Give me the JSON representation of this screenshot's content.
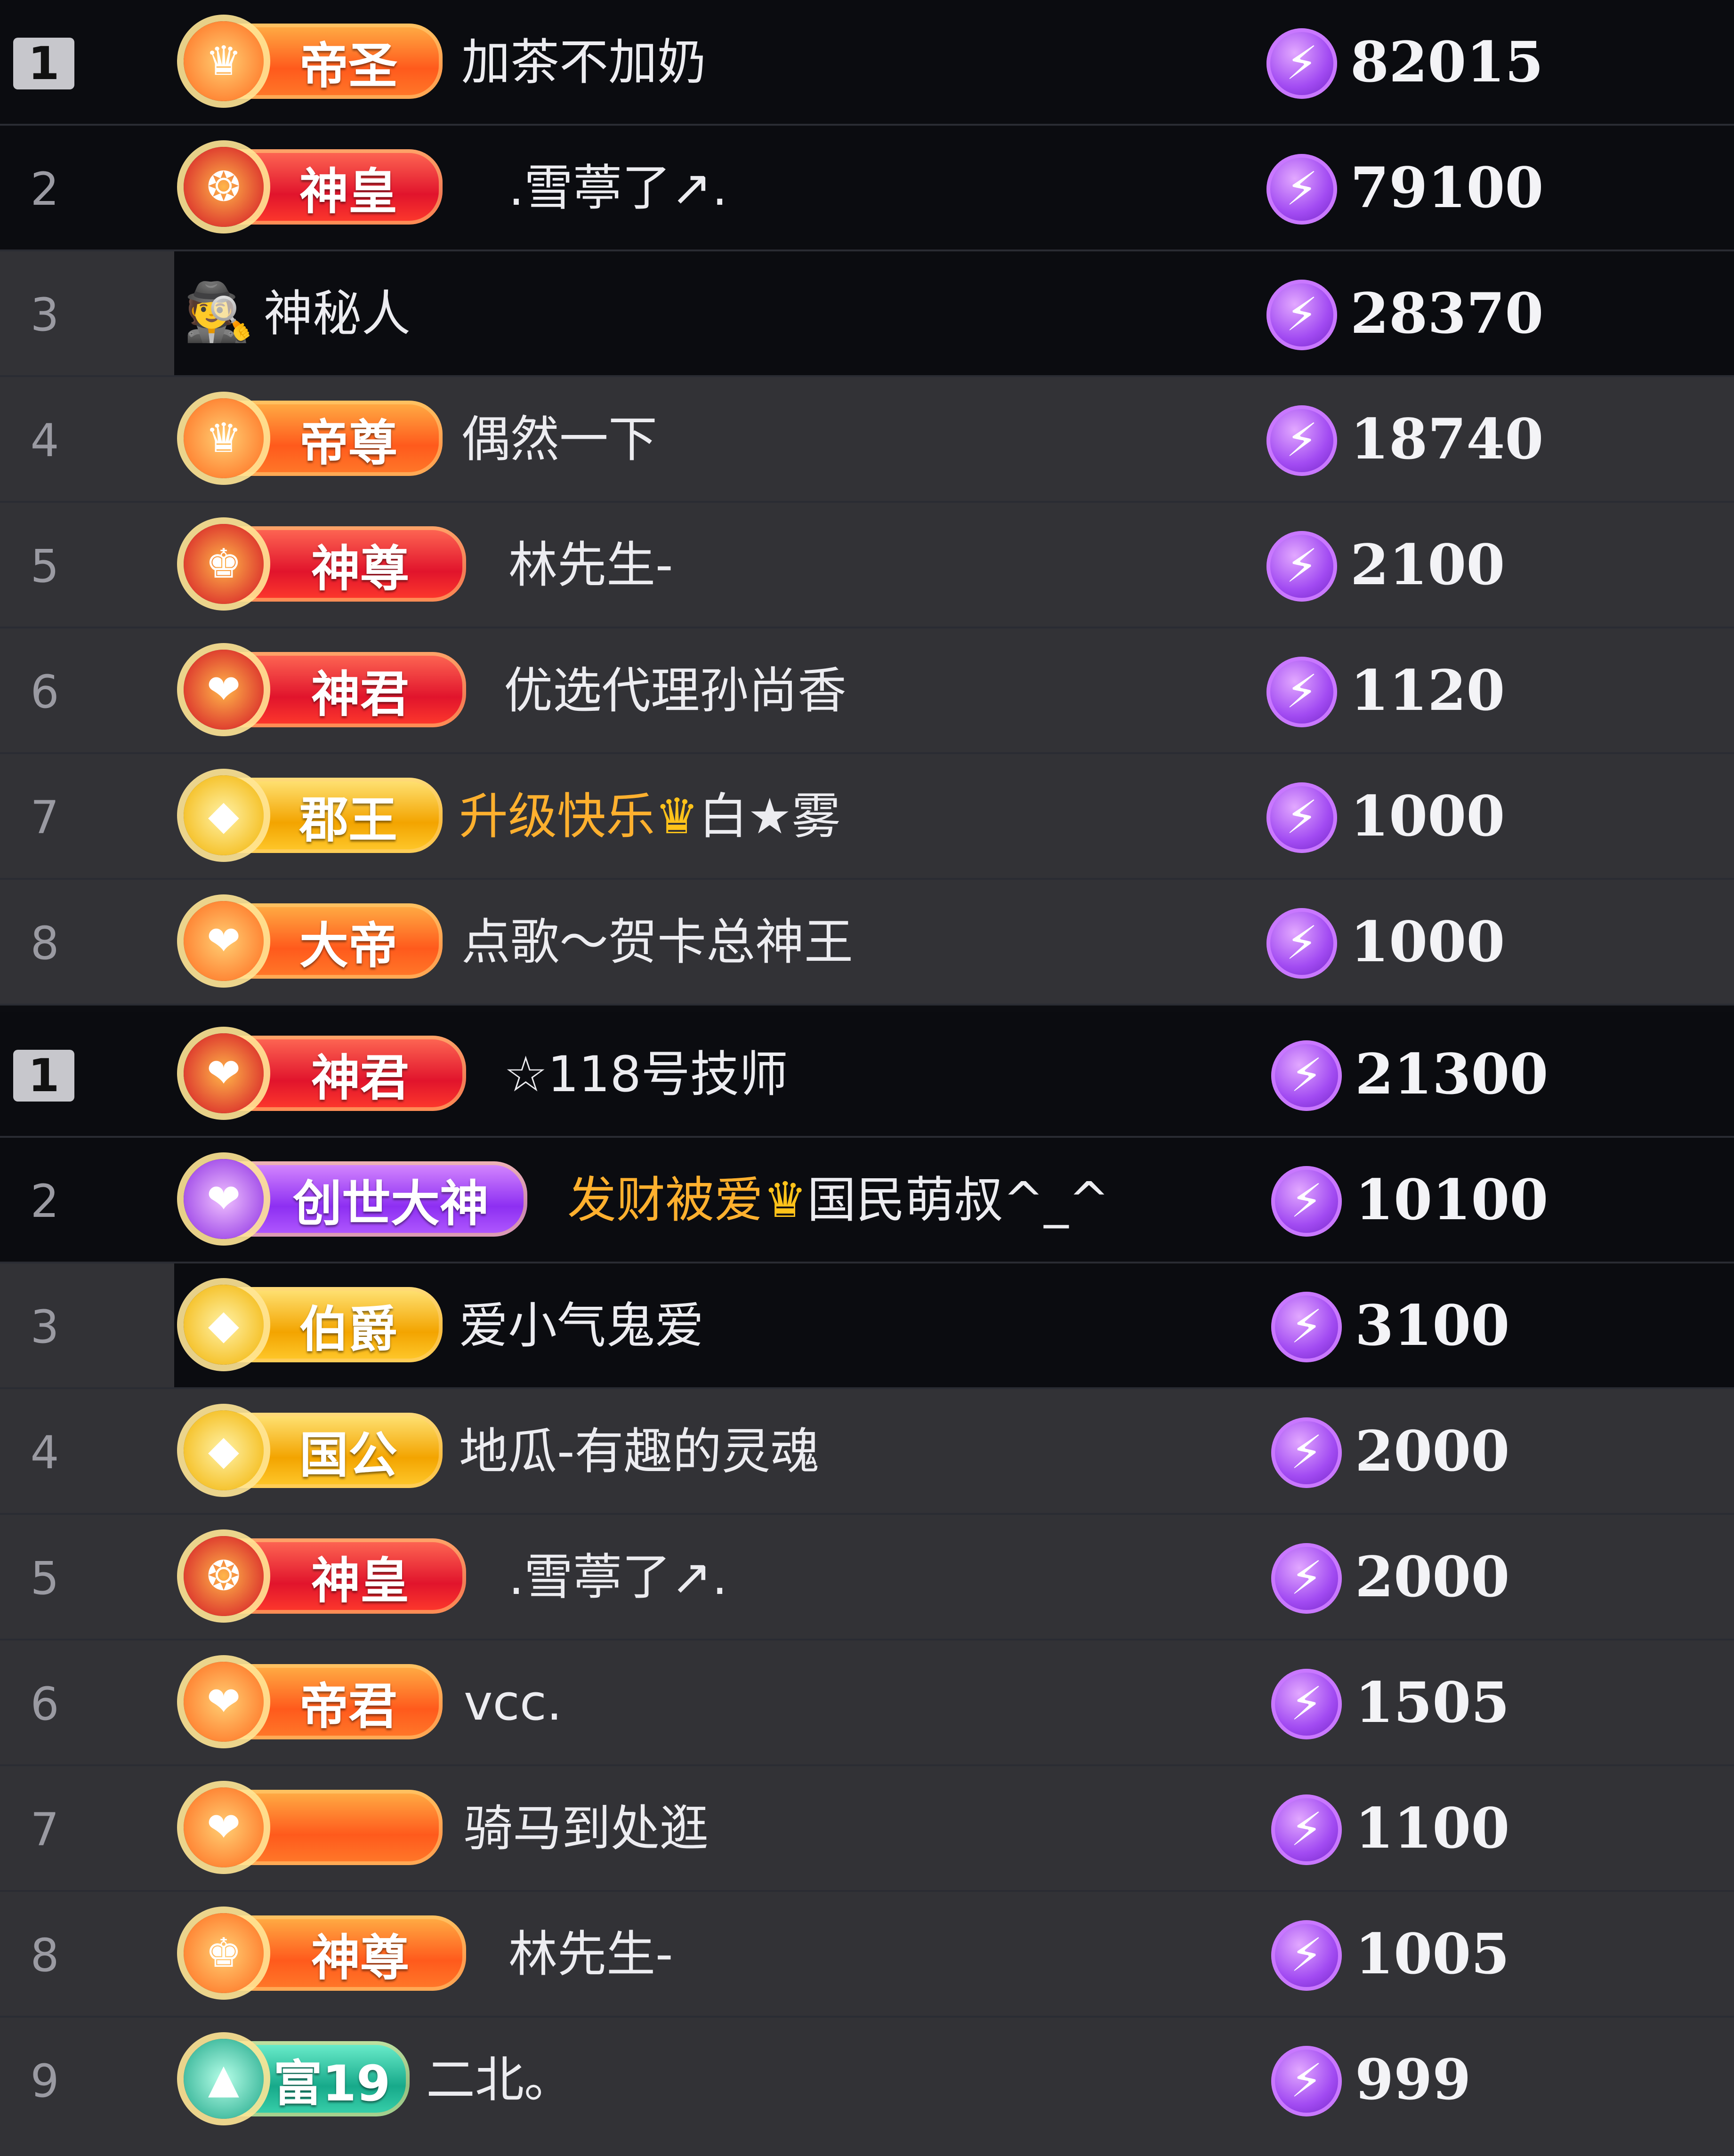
{
  "icons": {
    "mystery_avatar": "incognito-spy-icon",
    "currency": "lightning-bolt-coin-icon",
    "crown": "crown-icon"
  },
  "colors": {
    "row_dark": "#0b0c10",
    "row_grey": "#323236",
    "name_highlight": "#ffb02e",
    "currency": "#a24bf2"
  },
  "leaderboard_1": [
    {
      "rank": "1",
      "badge": "帝圣",
      "name": "加茶不加奶",
      "score": "82015"
    },
    {
      "rank": "2",
      "badge": "神皇",
      "name": ".雪葶了↗.",
      "score": "79100"
    },
    {
      "rank": "3",
      "badge": "",
      "name": "神秘人",
      "score": "28370"
    },
    {
      "rank": "4",
      "badge": "帝尊",
      "name": "偶然一下",
      "score": "18740"
    },
    {
      "rank": "5",
      "badge": "神尊",
      "name": "林先生-",
      "score": "2100"
    },
    {
      "rank": "6",
      "badge": "神君",
      "name": "优选代理孙尚香",
      "score": "1120"
    },
    {
      "rank": "7",
      "badge": "郡王",
      "name_prefix": "升级快乐",
      "name": "白★雾",
      "score": "1000"
    },
    {
      "rank": "8",
      "badge": "大帝",
      "name": "点歌～贺卡总神王",
      "score": "1000"
    }
  ],
  "leaderboard_2": [
    {
      "rank": "1",
      "badge": "神君",
      "name": "☆118号技师",
      "score": "21300"
    },
    {
      "rank": "2",
      "badge": "创世大神",
      "name_prefix": "发财被爱",
      "name": "国民萌叔^_^",
      "score": "10100"
    },
    {
      "rank": "3",
      "badge": "伯爵",
      "name": "爱小气鬼爱",
      "score": "3100"
    },
    {
      "rank": "4",
      "badge": "国公",
      "name": "地瓜-有趣的灵魂",
      "score": "2000"
    },
    {
      "rank": "5",
      "badge": "神皇",
      "name": ".雪葶了↗.",
      "score": "2000"
    },
    {
      "rank": "6",
      "badge": "帝君",
      "name": "vcc.",
      "score": "1505"
    },
    {
      "rank": "7",
      "badge": "",
      "name": "骑马到处逛",
      "score": "1100"
    },
    {
      "rank": "8",
      "badge": "神尊",
      "name": "林先生-",
      "score": "1005"
    },
    {
      "rank": "9",
      "badge": "富19",
      "name": "二北。",
      "score": "999"
    }
  ]
}
